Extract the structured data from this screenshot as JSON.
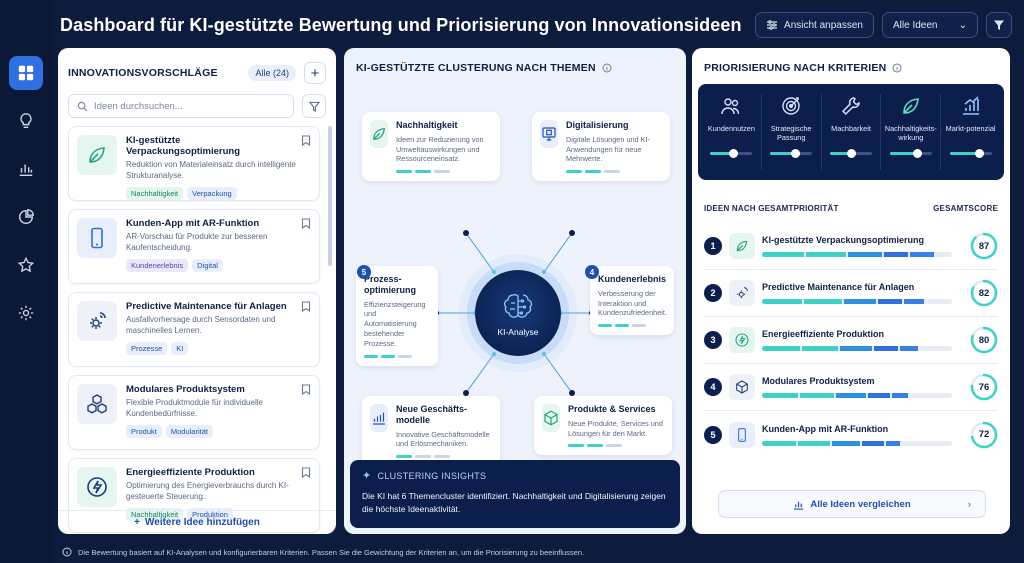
{
  "header": {
    "title": "Dashboard für KI-gestützte Bewertung und Priorisierung von Innovationsideen",
    "customize_label": "Ansicht anpassen",
    "select_label": "Alle Ideen"
  },
  "sidebar": {
    "items": [
      {
        "icon": "dashboard-icon",
        "active": true
      },
      {
        "icon": "lightbulb-icon"
      },
      {
        "icon": "bar-chart-icon"
      },
      {
        "icon": "pie-chart-icon"
      },
      {
        "icon": "star-icon"
      },
      {
        "icon": "gear-icon"
      }
    ]
  },
  "proposals": {
    "title": "INNOVATIONSVORSCHLÄGE",
    "count_badge": "Alle (24)",
    "search_placeholder": "Ideen durchsuchen...",
    "add_more": "Weitere Idee hinzufügen",
    "items": [
      {
        "title": "KI-gestützte Verpackungsoptimierung",
        "desc": "Reduktion von Materialeinsatz durch intelligente Strukturanalyse.",
        "tags": [
          "Nachhaltigkeit",
          "Verpackung"
        ],
        "icon": "leaf-icon"
      },
      {
        "title": "Kunden-App mit AR-Funktion",
        "desc": "AR-Vorschau für Produkte zur besseren Kaufentscheidung.",
        "tags": [
          "Kundenerlebnis",
          "Digital"
        ],
        "icon": "smartphone-icon"
      },
      {
        "title": "Predictive Maintenance für Anlagen",
        "desc": "Ausfallvorhersage durch Sensordaten und maschinelles Lernen.",
        "tags": [
          "Prozesse",
          "KI"
        ],
        "icon": "gear-signal-icon"
      },
      {
        "title": "Modulares Produktsystem",
        "desc": "Flexible Produktmodule für individuelle Kundenbedürfnisse.",
        "tags": [
          "Produkt",
          "Modularität"
        ],
        "icon": "cubes-icon"
      },
      {
        "title": "Energieeffiziente Produktion",
        "desc": "Optimierung des Energieverbrauchs durch KI-gesteuerte Steuerung.",
        "tags": [
          "Nachhaltigkeit",
          "Produktion"
        ],
        "icon": "lightning-icon"
      }
    ]
  },
  "clustering": {
    "title": "KI-GESTÜTZTE CLUSTERUNG NACH THEMEN",
    "hub_label": "KI-Analyse",
    "clusters": [
      {
        "title": "Nachhaltigkeit",
        "desc": "Ideen zur Reduzierung von Umweltauswirkungen und Ressourceneinsatz."
      },
      {
        "title": "Digitalisierung",
        "desc": "Digitale Lösungen und KI-Anwendungen für neue Mehrwerte."
      },
      {
        "num": "5",
        "title": "Prozess-optimierung",
        "desc": "Effizienzsteigerung und Automatisierung bestehender Prozesse."
      },
      {
        "num": "4",
        "title": "Kundenerlebnis",
        "desc": "Verbesserung der Interaktion und Kundenzufriedenheit."
      },
      {
        "title": "Neue Geschäfts-modelle",
        "desc": "Innovative Geschäftsmodelle und Erlösmechaniken."
      },
      {
        "title": "Produkte & Services",
        "desc": "Neue Produkte, Services und Lösungen für den Markt."
      }
    ],
    "insights_title": "CLUSTERING INSIGHTS",
    "insights_text": "Die KI hat 6 Themencluster identifiziert. Nachhaltigkeit und Digitalisierung zeigen die höchste Ideenaktivität."
  },
  "prioritization": {
    "title": "PRIORISIERUNG NACH KRITERIEN",
    "criteria": [
      {
        "label": "Kundennutzen",
        "value": 0.55,
        "icon": "users-icon"
      },
      {
        "label": "Strategische Passung",
        "value": 0.6,
        "icon": "target-icon"
      },
      {
        "label": "Machbarkeit",
        "value": 0.5,
        "icon": "wrench-icon"
      },
      {
        "label": "Nachhaltigkeits-wirkung",
        "value": 0.65,
        "icon": "leaf-icon"
      },
      {
        "label": "Markt-potenzial",
        "value": 0.7,
        "icon": "growth-chart-icon"
      }
    ],
    "rank_header": "IDEEN NACH GESAMTPRIORITÄT",
    "score_header": "GESAMTSCORE",
    "ranked": [
      {
        "rank": "1",
        "title": "KI-gestützte Verpackungsoptimierung",
        "score": 87,
        "icon": "leaf-icon"
      },
      {
        "rank": "2",
        "title": "Predictive Maintenance für Anlagen",
        "score": 82,
        "icon": "gear-signal-icon"
      },
      {
        "rank": "3",
        "title": "Energieeffiziente Produktion",
        "score": 80,
        "icon": "lightning-icon"
      },
      {
        "rank": "4",
        "title": "Modulares Produktsystem",
        "score": 76,
        "icon": "cube-icon"
      },
      {
        "rank": "5",
        "title": "Kunden-App mit AR-Funktion",
        "score": 72,
        "icon": "smartphone-icon"
      }
    ],
    "compare_label": "Alle Ideen vergleichen"
  },
  "footer": {
    "text": "Die Bewertung basiert auf KI-Analysen und konfigurierbaren Kriterien. Passen Sie die Gewichtung der Kriterien an, um die Priorisierung zu beeinflussen."
  },
  "colors": {
    "navy": "#0c1f4c",
    "accent_blue": "#2f6fe0",
    "teal": "#3fd1c8"
  }
}
